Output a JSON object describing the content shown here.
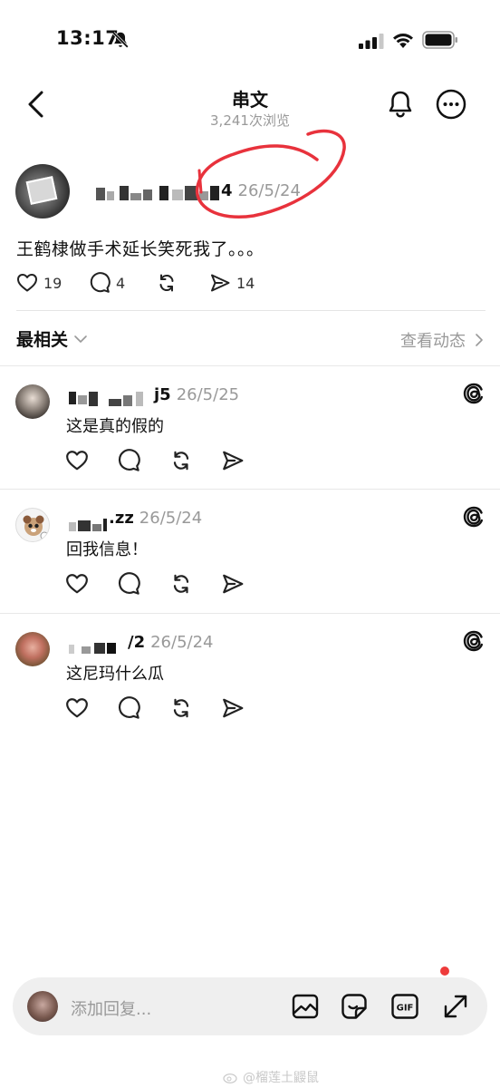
{
  "status_bar": {
    "time": "13:17"
  },
  "header": {
    "title": "串文",
    "views": "3,241次浏览"
  },
  "post": {
    "handle_suffix": "4",
    "date": "26/5/24",
    "text": "王鹤棣做手术延长笑死我了。。。",
    "likes": "19",
    "comments": "4",
    "shares": "14"
  },
  "sort_bar": {
    "sort_label": "最相关",
    "activity_label": "查看动态"
  },
  "replies": [
    {
      "handle_suffix": "j5",
      "date": "26/5/25",
      "text": "这是真的假的"
    },
    {
      "handle_suffix": ".zz",
      "date": "26/5/24",
      "text": "回我信息！"
    },
    {
      "handle_suffix": "/2",
      "date": "26/5/24",
      "text": "这尼玛什么瓜"
    }
  ],
  "composer": {
    "placeholder": "添加回复...",
    "gif_label": "GIF"
  },
  "watermark": "@榴莲土鼹鼠",
  "colors": {
    "annotation_red": "#e8323c",
    "secondary_text": "#999999"
  }
}
